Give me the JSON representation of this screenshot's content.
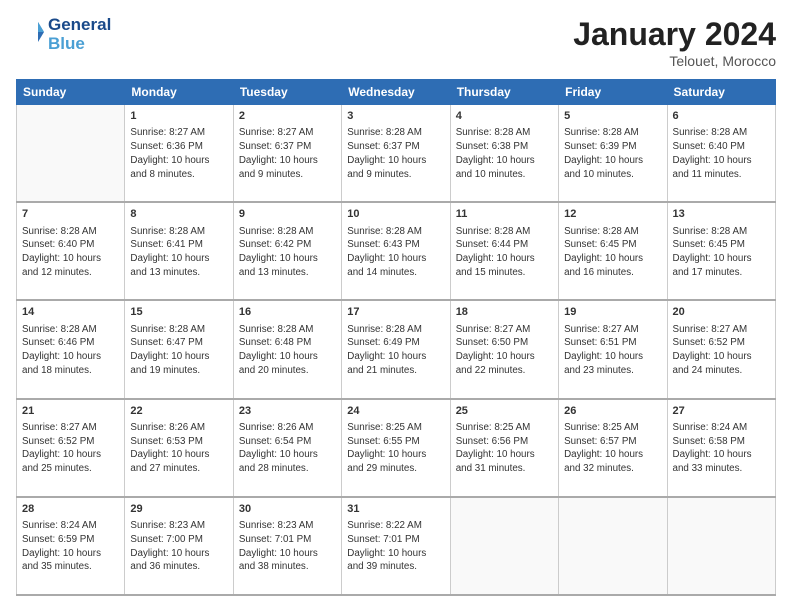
{
  "logo": {
    "line1": "General",
    "line2": "Blue"
  },
  "title": "January 2024",
  "subtitle": "Telouet, Morocco",
  "headers": [
    "Sunday",
    "Monday",
    "Tuesday",
    "Wednesday",
    "Thursday",
    "Friday",
    "Saturday"
  ],
  "weeks": [
    [
      {
        "day": "",
        "info": ""
      },
      {
        "day": "1",
        "info": "Sunrise: 8:27 AM\nSunset: 6:36 PM\nDaylight: 10 hours\nand 8 minutes."
      },
      {
        "day": "2",
        "info": "Sunrise: 8:27 AM\nSunset: 6:37 PM\nDaylight: 10 hours\nand 9 minutes."
      },
      {
        "day": "3",
        "info": "Sunrise: 8:28 AM\nSunset: 6:37 PM\nDaylight: 10 hours\nand 9 minutes."
      },
      {
        "day": "4",
        "info": "Sunrise: 8:28 AM\nSunset: 6:38 PM\nDaylight: 10 hours\nand 10 minutes."
      },
      {
        "day": "5",
        "info": "Sunrise: 8:28 AM\nSunset: 6:39 PM\nDaylight: 10 hours\nand 10 minutes."
      },
      {
        "day": "6",
        "info": "Sunrise: 8:28 AM\nSunset: 6:40 PM\nDaylight: 10 hours\nand 11 minutes."
      }
    ],
    [
      {
        "day": "7",
        "info": "Sunrise: 8:28 AM\nSunset: 6:40 PM\nDaylight: 10 hours\nand 12 minutes."
      },
      {
        "day": "8",
        "info": "Sunrise: 8:28 AM\nSunset: 6:41 PM\nDaylight: 10 hours\nand 13 minutes."
      },
      {
        "day": "9",
        "info": "Sunrise: 8:28 AM\nSunset: 6:42 PM\nDaylight: 10 hours\nand 13 minutes."
      },
      {
        "day": "10",
        "info": "Sunrise: 8:28 AM\nSunset: 6:43 PM\nDaylight: 10 hours\nand 14 minutes."
      },
      {
        "day": "11",
        "info": "Sunrise: 8:28 AM\nSunset: 6:44 PM\nDaylight: 10 hours\nand 15 minutes."
      },
      {
        "day": "12",
        "info": "Sunrise: 8:28 AM\nSunset: 6:45 PM\nDaylight: 10 hours\nand 16 minutes."
      },
      {
        "day": "13",
        "info": "Sunrise: 8:28 AM\nSunset: 6:45 PM\nDaylight: 10 hours\nand 17 minutes."
      }
    ],
    [
      {
        "day": "14",
        "info": "Sunrise: 8:28 AM\nSunset: 6:46 PM\nDaylight: 10 hours\nand 18 minutes."
      },
      {
        "day": "15",
        "info": "Sunrise: 8:28 AM\nSunset: 6:47 PM\nDaylight: 10 hours\nand 19 minutes."
      },
      {
        "day": "16",
        "info": "Sunrise: 8:28 AM\nSunset: 6:48 PM\nDaylight: 10 hours\nand 20 minutes."
      },
      {
        "day": "17",
        "info": "Sunrise: 8:28 AM\nSunset: 6:49 PM\nDaylight: 10 hours\nand 21 minutes."
      },
      {
        "day": "18",
        "info": "Sunrise: 8:27 AM\nSunset: 6:50 PM\nDaylight: 10 hours\nand 22 minutes."
      },
      {
        "day": "19",
        "info": "Sunrise: 8:27 AM\nSunset: 6:51 PM\nDaylight: 10 hours\nand 23 minutes."
      },
      {
        "day": "20",
        "info": "Sunrise: 8:27 AM\nSunset: 6:52 PM\nDaylight: 10 hours\nand 24 minutes."
      }
    ],
    [
      {
        "day": "21",
        "info": "Sunrise: 8:27 AM\nSunset: 6:52 PM\nDaylight: 10 hours\nand 25 minutes."
      },
      {
        "day": "22",
        "info": "Sunrise: 8:26 AM\nSunset: 6:53 PM\nDaylight: 10 hours\nand 27 minutes."
      },
      {
        "day": "23",
        "info": "Sunrise: 8:26 AM\nSunset: 6:54 PM\nDaylight: 10 hours\nand 28 minutes."
      },
      {
        "day": "24",
        "info": "Sunrise: 8:25 AM\nSunset: 6:55 PM\nDaylight: 10 hours\nand 29 minutes."
      },
      {
        "day": "25",
        "info": "Sunrise: 8:25 AM\nSunset: 6:56 PM\nDaylight: 10 hours\nand 31 minutes."
      },
      {
        "day": "26",
        "info": "Sunrise: 8:25 AM\nSunset: 6:57 PM\nDaylight: 10 hours\nand 32 minutes."
      },
      {
        "day": "27",
        "info": "Sunrise: 8:24 AM\nSunset: 6:58 PM\nDaylight: 10 hours\nand 33 minutes."
      }
    ],
    [
      {
        "day": "28",
        "info": "Sunrise: 8:24 AM\nSunset: 6:59 PM\nDaylight: 10 hours\nand 35 minutes."
      },
      {
        "day": "29",
        "info": "Sunrise: 8:23 AM\nSunset: 7:00 PM\nDaylight: 10 hours\nand 36 minutes."
      },
      {
        "day": "30",
        "info": "Sunrise: 8:23 AM\nSunset: 7:01 PM\nDaylight: 10 hours\nand 38 minutes."
      },
      {
        "day": "31",
        "info": "Sunrise: 8:22 AM\nSunset: 7:01 PM\nDaylight: 10 hours\nand 39 minutes."
      },
      {
        "day": "",
        "info": ""
      },
      {
        "day": "",
        "info": ""
      },
      {
        "day": "",
        "info": ""
      }
    ]
  ]
}
